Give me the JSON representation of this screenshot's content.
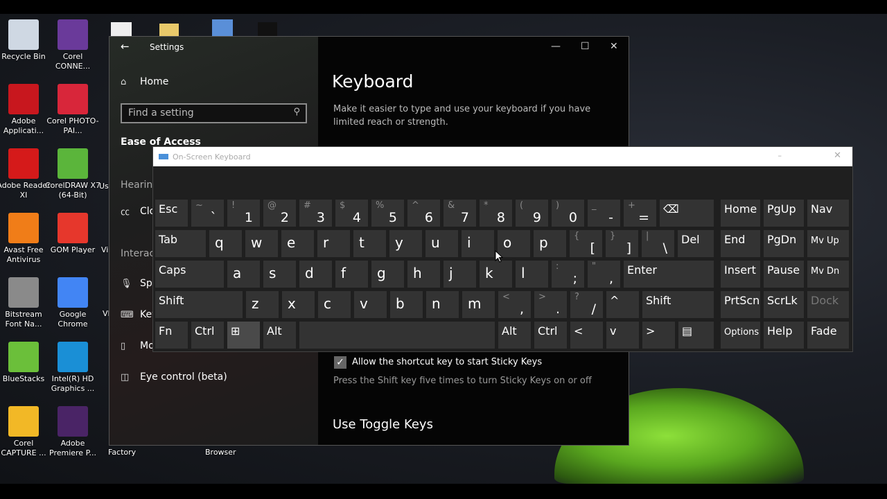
{
  "desktop": {
    "icons": [
      {
        "label": "Recycle Bin",
        "color": "#cfd8e3"
      },
      {
        "label": "Corel CONNE...",
        "color": "#6a3a9a"
      },
      {
        "label": "Adobe Applicati...",
        "color": "#c8171e"
      },
      {
        "label": "Corel PHOTO-PAI...",
        "color": "#d8263a"
      },
      {
        "label": "Adobe Reader XI",
        "color": "#d51a1a"
      },
      {
        "label": "CorelDRAW X7 (64-Bit)",
        "color": "#5bb53b"
      },
      {
        "label": "Avast Free Antivirus",
        "color": "#f07d18"
      },
      {
        "label": "GOM Player",
        "color": "#e6372c"
      },
      {
        "label": "Bitstream Font Na...",
        "color": "#8a8a8a"
      },
      {
        "label": "Google Chrome",
        "color": "#4285f4"
      },
      {
        "label": "BlueStacks",
        "color": "#6bbf3a"
      },
      {
        "label": "Intel(R) HD Graphics ...",
        "color": "#1a8fd6"
      },
      {
        "label": "Corel CAPTURE ...",
        "color": "#f2b826"
      },
      {
        "label": "Adobe Premiere P...",
        "color": "#4a2466"
      }
    ],
    "partial_labels": [
      "Us",
      "Vi",
      "Vl",
      "Factory",
      "Browser"
    ]
  },
  "settings": {
    "title": "Settings",
    "home": "Home",
    "search_placeholder": "Find a setting",
    "category": "Ease of Access",
    "sections": {
      "hearing": "Hearing",
      "interaction": "Interact"
    },
    "nav": {
      "captions": "Clo",
      "speech": "Spe",
      "keyboard": "Key",
      "mouse": "Mo",
      "eye": "Eye control (beta)"
    },
    "page_title": "Keyboard",
    "description": "Make it easier to type and use your keyboard if you have limited reach or strength.",
    "sticky_checkbox_label": "Allow the shortcut key to start Sticky Keys",
    "sticky_checkbox_checked": true,
    "sticky_hint": "Press the Shift key five times to turn Sticky Keys on or off",
    "toggle_heading": "Use Toggle Keys"
  },
  "osk": {
    "title": "On-Screen Keyboard",
    "rows": [
      [
        {
          "m": "Esc"
        },
        {
          "s": "~",
          "l": "`"
        },
        {
          "s": "!",
          "l": "1"
        },
        {
          "s": "@",
          "l": "2"
        },
        {
          "s": "#",
          "l": "3"
        },
        {
          "s": "$",
          "l": "4"
        },
        {
          "s": "%",
          "l": "5"
        },
        {
          "s": "^",
          "l": "6"
        },
        {
          "s": "&",
          "l": "7"
        },
        {
          "s": "*",
          "l": "8"
        },
        {
          "s": "(",
          "l": "9"
        },
        {
          "s": ")",
          "l": "0"
        },
        {
          "s": "_",
          "l": "-"
        },
        {
          "s": "+",
          "l": "="
        },
        {
          "m": "⌫"
        }
      ],
      [
        {
          "m": "Tab"
        },
        {
          "m": "q",
          "t": 1
        },
        {
          "m": "w",
          "t": 1
        },
        {
          "m": "e",
          "t": 1
        },
        {
          "m": "r",
          "t": 1
        },
        {
          "m": "t",
          "t": 1
        },
        {
          "m": "y",
          "t": 1
        },
        {
          "m": "u",
          "t": 1
        },
        {
          "m": "i",
          "t": 1
        },
        {
          "m": "o",
          "t": 1
        },
        {
          "m": "p",
          "t": 1
        },
        {
          "s": "{",
          "l": "["
        },
        {
          "s": "}",
          "l": "]"
        },
        {
          "s": "|",
          "l": "\\"
        },
        {
          "m": "Del"
        }
      ],
      [
        {
          "m": "Caps"
        },
        {
          "m": "a",
          "t": 1
        },
        {
          "m": "s",
          "t": 1
        },
        {
          "m": "d",
          "t": 1
        },
        {
          "m": "f",
          "t": 1
        },
        {
          "m": "g",
          "t": 1
        },
        {
          "m": "h",
          "t": 1
        },
        {
          "m": "j",
          "t": 1
        },
        {
          "m": "k",
          "t": 1
        },
        {
          "m": "l",
          "t": 1
        },
        {
          "s": ":",
          "l": ";"
        },
        {
          "s": "\"",
          "l": ","
        },
        {
          "m": "Enter"
        }
      ],
      [
        {
          "m": "Shift"
        },
        {
          "m": "z",
          "t": 1
        },
        {
          "m": "x",
          "t": 1
        },
        {
          "m": "c",
          "t": 1
        },
        {
          "m": "v",
          "t": 1
        },
        {
          "m": "b",
          "t": 1
        },
        {
          "m": "n",
          "t": 1
        },
        {
          "m": "m",
          "t": 1
        },
        {
          "s": "<",
          "l": ","
        },
        {
          "s": ">",
          "l": "."
        },
        {
          "s": "?",
          "l": "/"
        },
        {
          "m": "^"
        },
        {
          "m": "Shift"
        }
      ],
      [
        {
          "m": "Fn"
        },
        {
          "m": "Ctrl"
        },
        {
          "m": "⊞",
          "hi": 1
        },
        {
          "m": "Alt"
        },
        {
          "m": ""
        },
        {
          "m": "Alt"
        },
        {
          "m": "Ctrl"
        },
        {
          "m": "<"
        },
        {
          "m": "v"
        },
        {
          "m": ">"
        },
        {
          "m": "▤"
        }
      ]
    ],
    "nav_keys": [
      "Home",
      "PgUp",
      "Nav",
      "End",
      "PgDn",
      "Mv Up",
      "Insert",
      "Pause",
      "Mv Dn",
      "PrtScn",
      "ScrLk",
      "Dock",
      "Options",
      "Help",
      "Fade"
    ],
    "disabled_keys": [
      "Dock"
    ]
  }
}
